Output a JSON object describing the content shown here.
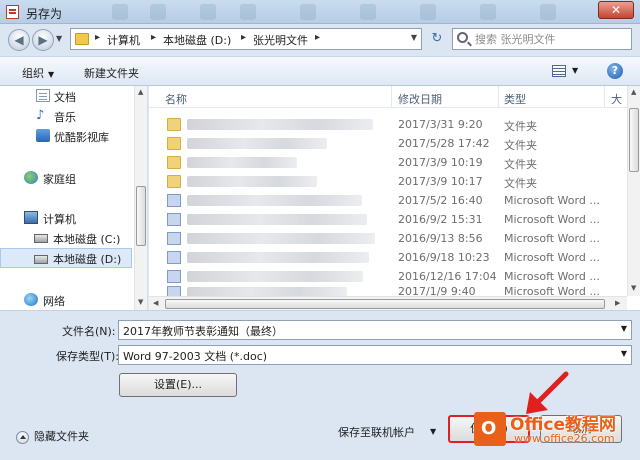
{
  "window": {
    "title": "另存为",
    "close_label": "✕"
  },
  "address": {
    "crumbs": [
      "计算机",
      "本地磁盘 (D:)",
      "张光明文件"
    ],
    "search_placeholder": "搜索 张光明文件"
  },
  "toolbar": {
    "organize": "组织",
    "new_folder": "新建文件夹",
    "help": "?"
  },
  "nav": {
    "items": [
      {
        "label": "文档",
        "icon": "document-icon"
      },
      {
        "label": "音乐",
        "icon": "music-icon"
      },
      {
        "label": "优酷影视库",
        "icon": "video-library-icon"
      },
      {
        "label": "家庭组",
        "icon": "homegroup-icon"
      },
      {
        "label": "计算机",
        "icon": "computer-icon"
      },
      {
        "label": "本地磁盘 (C:)",
        "icon": "drive-icon"
      },
      {
        "label": "本地磁盘 (D:)",
        "icon": "drive-icon",
        "selected": true
      },
      {
        "label": "网络",
        "icon": "network-icon"
      }
    ]
  },
  "files": {
    "columns": {
      "name": "名称",
      "date": "修改日期",
      "type": "类型",
      "size": "大"
    },
    "rows": [
      {
        "date": "2017/3/31 9:20",
        "type": "文件夹",
        "kind": "folder"
      },
      {
        "date": "2017/5/28 17:42",
        "type": "文件夹",
        "kind": "folder"
      },
      {
        "date": "2017/3/9 10:19",
        "type": "文件夹",
        "kind": "folder"
      },
      {
        "date": "2017/3/9 10:17",
        "type": "文件夹",
        "kind": "folder"
      },
      {
        "date": "2017/5/2 16:40",
        "type": "Microsoft Word ...",
        "kind": "word"
      },
      {
        "date": "2016/9/2 15:31",
        "type": "Microsoft Word ...",
        "kind": "word"
      },
      {
        "date": "2016/9/13 8:56",
        "type": "Microsoft Word ...",
        "kind": "word"
      },
      {
        "date": "2016/9/18 10:23",
        "type": "Microsoft Word ...",
        "kind": "word"
      },
      {
        "date": "2016/12/16 17:04",
        "type": "Microsoft Word ...",
        "kind": "word"
      },
      {
        "date": "2017/1/9 9:40",
        "type": "Microsoft Word ...",
        "kind": "word"
      }
    ]
  },
  "form": {
    "filename_label": "文件名(N):",
    "filename_value": "2017年教师节表彰通知（最终）",
    "filetype_label": "保存类型(T):",
    "filetype_value": "Word 97-2003 文档 (*.doc)",
    "settings_button": "设置(E)...",
    "hide_folders": "隐藏文件夹",
    "save_online": "保存至联机帐户",
    "save_button": "保存(S)",
    "cancel_button": "取消"
  },
  "watermark": {
    "title": "Office教程网",
    "url": "www.office26.com"
  },
  "colors": {
    "highlight": "#e02020",
    "accent": "#e8601a"
  }
}
